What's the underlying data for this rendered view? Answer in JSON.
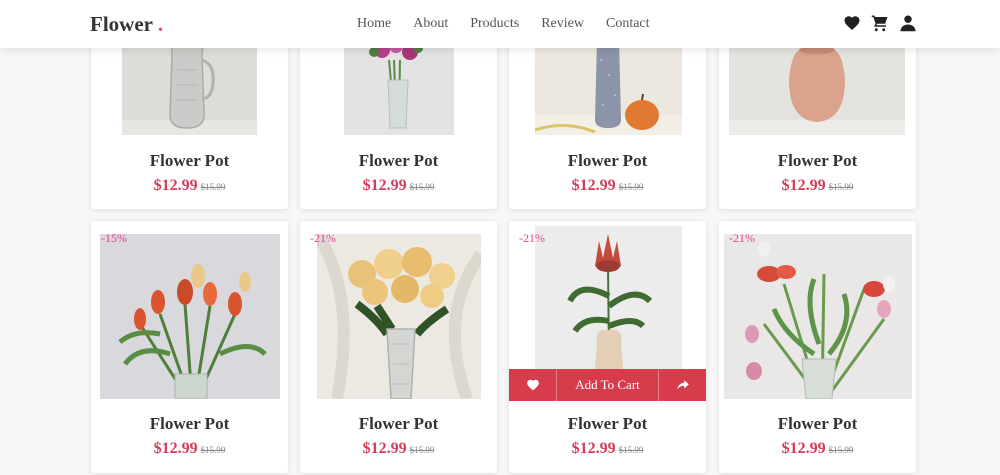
{
  "header": {
    "logo_text": "Flower",
    "logo_dot": ".",
    "nav": [
      "Home",
      "About",
      "Products",
      "Review",
      "Contact"
    ],
    "icons": [
      "heart-icon",
      "cart-icon",
      "user-icon"
    ]
  },
  "products": [
    {
      "title": "Flower Pot",
      "price": "$12.99",
      "old_price": "$15.99"
    },
    {
      "title": "Flower Pot",
      "price": "$12.99",
      "old_price": "$15.99"
    },
    {
      "title": "Flower Pot",
      "price": "$12.99",
      "old_price": "$15.99"
    },
    {
      "title": "Flower Pot",
      "price": "$12.99",
      "old_price": "$15.99"
    },
    {
      "title": "Flower Pot",
      "price": "$12.99",
      "old_price": "$15.99",
      "discount": "-15%"
    },
    {
      "title": "Flower Pot",
      "price": "$12.99",
      "old_price": "$15.99",
      "discount": "-21%"
    },
    {
      "title": "Flower Pot",
      "price": "$12.99",
      "old_price": "$15.99",
      "discount": "-21%"
    },
    {
      "title": "Flower Pot",
      "price": "$12.99",
      "old_price": "$15.99",
      "discount": "-21%"
    }
  ],
  "cart_bar": {
    "label": "Add To Cart"
  },
  "colors": {
    "accent": "#e84393",
    "price": "#d63c58",
    "cart_bar": "#d63c4c"
  }
}
